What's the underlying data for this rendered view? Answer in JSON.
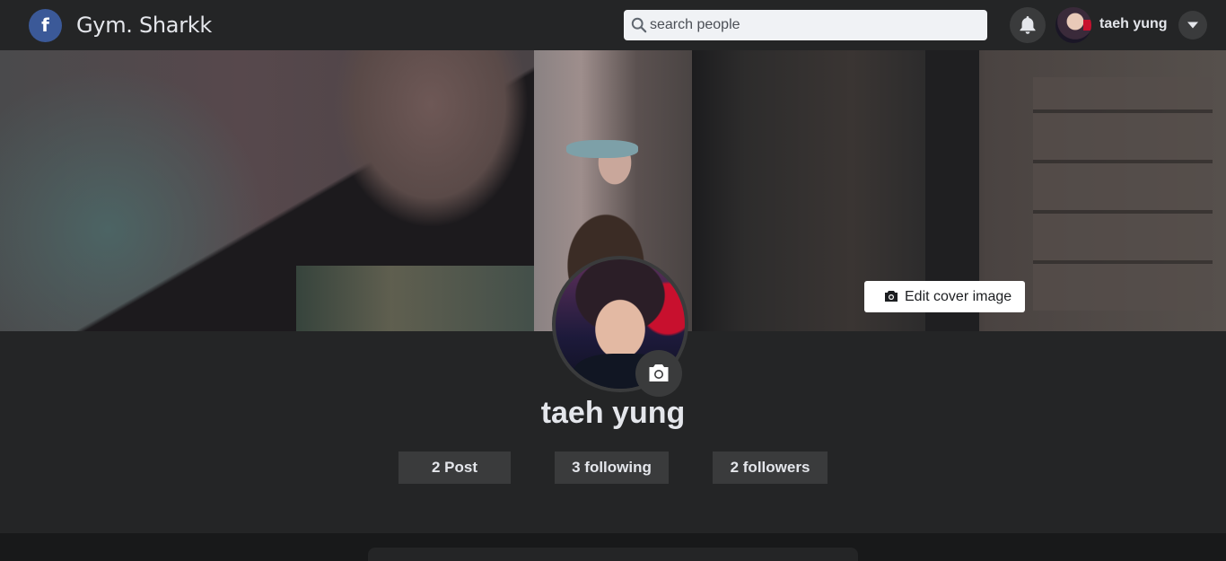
{
  "topbar": {
    "logo_letter": "f",
    "brand": "Gym. Sharkk",
    "search_placeholder": "search people",
    "user_name": "taeh yung"
  },
  "cover": {
    "edit_label": "Edit cover image"
  },
  "profile": {
    "name": "taeh yung",
    "stats": {
      "posts": "2 Post",
      "following": "3 following",
      "followers": "2 followers"
    }
  },
  "colors": {
    "topbar_bg": "#242526",
    "page_bg": "#18191a",
    "button_bg": "#3a3b3c",
    "logo_blue": "#3b5998"
  },
  "icons": [
    "facebook-logo-icon",
    "search-icon",
    "bell-icon",
    "avatar",
    "chevron-down-icon",
    "camera-icon"
  ]
}
